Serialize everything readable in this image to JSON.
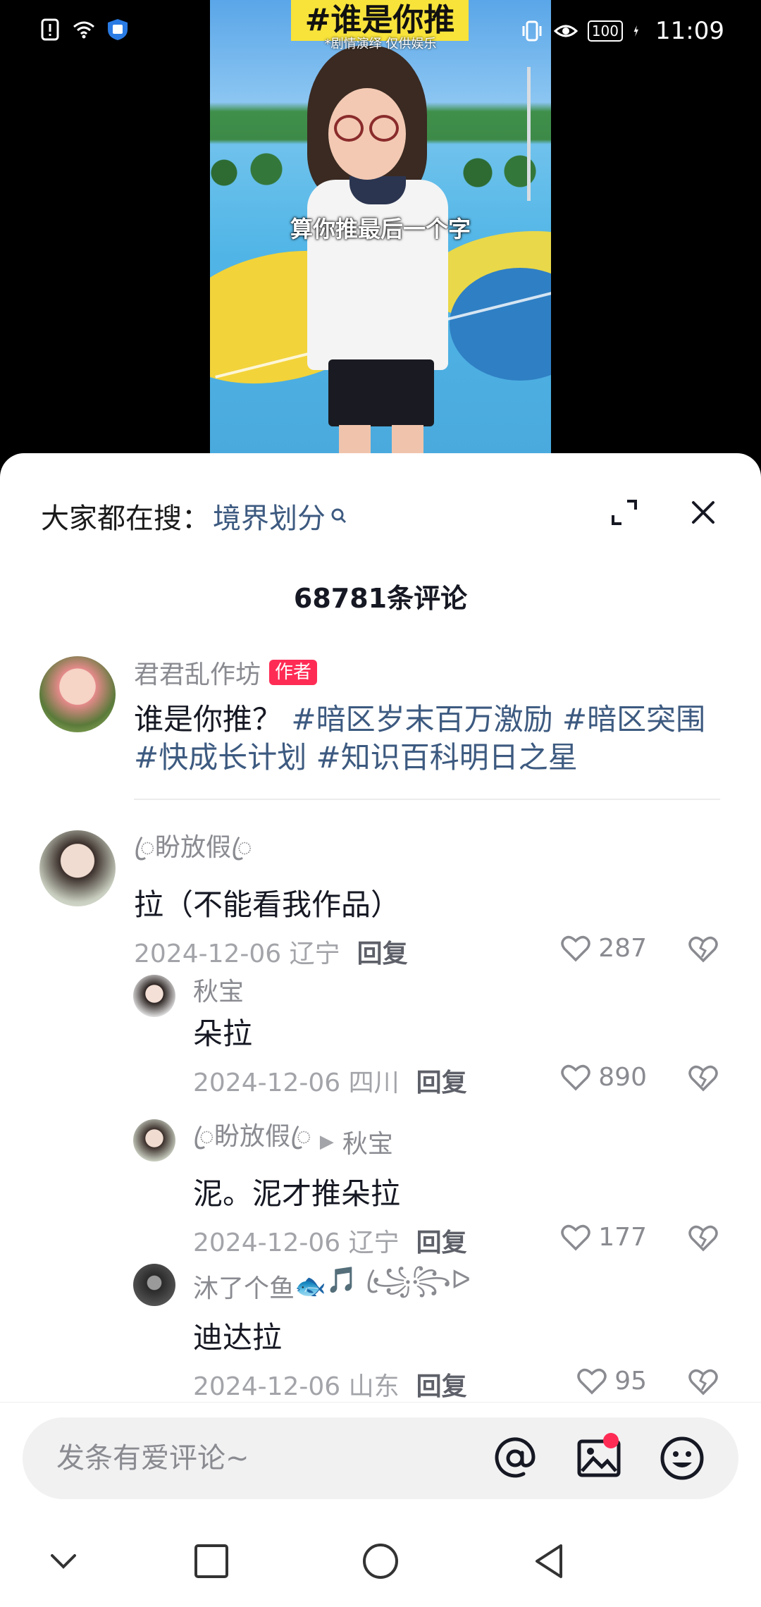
{
  "status_bar": {
    "time": "11:09",
    "battery": "100",
    "icons": [
      "alert-icon",
      "wifi-icon",
      "shield-icon",
      "vibrate-icon",
      "eye-icon",
      "charging-icon"
    ]
  },
  "video": {
    "title": "#谁是你推",
    "disclaimer": "*剧情演绎 仅供娱乐",
    "caption": "算你推最后一个字"
  },
  "sheet": {
    "search_prefix": "大家都在搜：",
    "search_term": "境界划分",
    "comment_count": "68781条评论"
  },
  "author_post": {
    "name": "君君乱作坊",
    "tag": "作者",
    "text_plain": "谁是你推？",
    "hashtags": "#暗区岁末百万激励 #暗区突围 #快成长计划 #知识百科明日之星"
  },
  "comments": [
    {
      "name": "ꦿ盼放假ꦿ",
      "text": "拉（不能看我作品）",
      "date": "2024-12-06 辽宁",
      "reply": "回复",
      "likes": "287"
    }
  ],
  "replies": [
    {
      "name": "秋宝",
      "text": "朵拉",
      "date": "2024-12-06 四川",
      "reply": "回复",
      "likes": "890"
    },
    {
      "name": "ꦿ盼放假ꦿ",
      "reply_to": "秋宝",
      "text": "泥。泥才推朵拉",
      "date": "2024-12-06 辽宁",
      "reply": "回复",
      "likes": "177"
    },
    {
      "name": "沐了个鱼",
      "name_suffix": "🎵 ꧁ꦿ꧂ᐅ",
      "text": "迪达拉",
      "date": "2024-12-06 山东",
      "reply": "回复",
      "likes": "95"
    }
  ],
  "input": {
    "placeholder": "发条有爱评论~"
  },
  "colors": {
    "accent": "#fe2c55",
    "link": "#3d5a80",
    "secondary_text": "#8a8b91",
    "primary_text": "#161823"
  }
}
